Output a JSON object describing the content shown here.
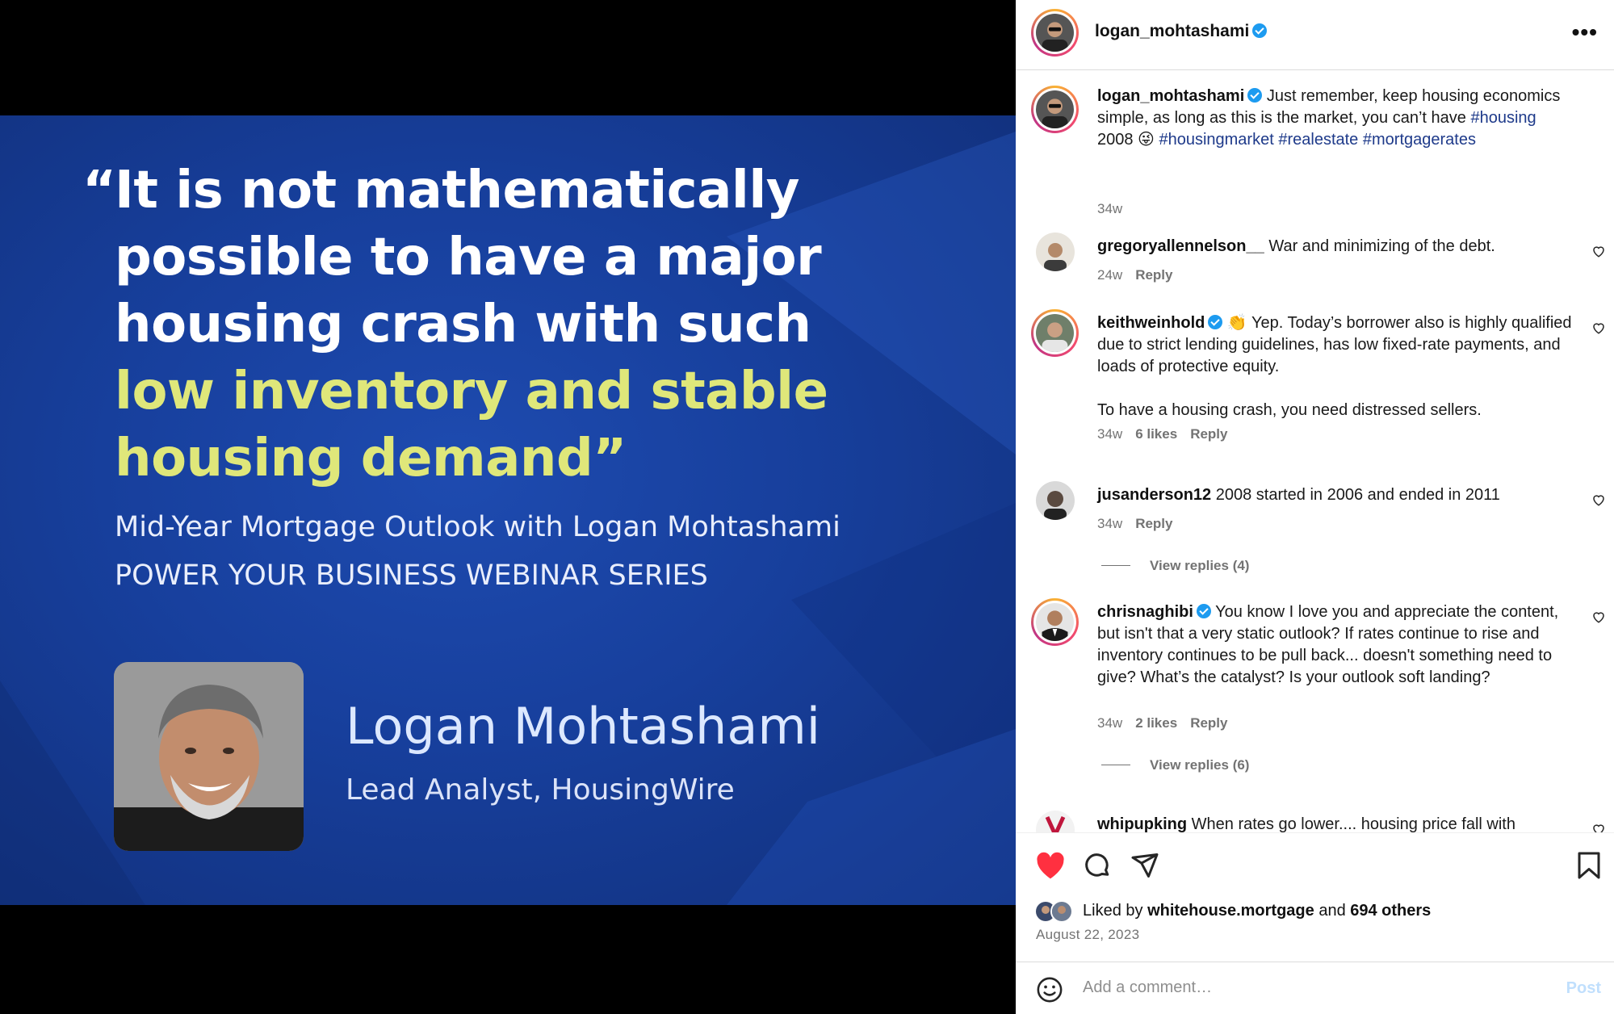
{
  "slide": {
    "quote_lines": [
      "It is not mathematically",
      "possible to have a major",
      "housing crash with such",
      "low inventory and stable",
      "housing demand”"
    ],
    "open_quote": "“",
    "subtitle_1": "Mid-Year Mortgage Outlook with Logan Mohtashami",
    "subtitle_2": "POWER YOUR BUSINESS WEBINAR SERIES",
    "speaker_name": "Logan Mohtashami",
    "speaker_title": "Lead Analyst, HousingWire",
    "colors": {
      "background": "#173f9c",
      "highlight": "#dfe77a"
    }
  },
  "header": {
    "username": "logan_mohtashami",
    "more": "•••"
  },
  "caption": {
    "username": "logan_mohtashami",
    "text_1": "Just remember, keep housing economics simple, as long as this is the market, you can’t have ",
    "tag_1": "#housing",
    "text_2": " 2008 😜 ",
    "tag_2": "#housingmarket",
    "tag_3": "#realestate",
    "tag_4": "#mortgagerates",
    "time": "34w"
  },
  "comments": [
    {
      "username": "gregoryallennelson__",
      "text": "War and minimizing of the debt.",
      "time": "24w",
      "likes": "",
      "reply": "Reply"
    },
    {
      "username": "keithweinhold",
      "text": "👏 Yep. Today’s borrower also is highly qualified due to strict lending guidelines, has low fixed-rate payments, and loads of protective equity.",
      "text_2": "To have a housing crash, you need distressed sellers.",
      "time": "34w",
      "likes": "6 likes",
      "reply": "Reply"
    },
    {
      "username": "jusanderson12",
      "text": "2008 started in 2006 and ended in 2011",
      "time": "34w",
      "likes": "",
      "reply": "Reply",
      "view_replies": "View replies (4)"
    },
    {
      "username": "chrisnaghibi",
      "text": "You know I love you and appreciate the content, but isn't that a very static outlook? If rates continue to rise and inventory continues to be pull back... doesn't something need to give? What’s the catalyst? Is your outlook soft landing?",
      "time": "34w",
      "likes": "2 likes",
      "reply": "Reply",
      "view_replies": "View replies (6)"
    },
    {
      "username": "whipupking",
      "text": "When rates go lower.... housing price fall with"
    }
  ],
  "likes": {
    "prefix": "Liked by ",
    "user": "whitehouse.mortgage",
    "middle": " and ",
    "count": "694 others"
  },
  "date": "August 22, 2023",
  "add_comment": {
    "placeholder": "Add a comment…",
    "post_label": "Post"
  },
  "colors": {
    "heart": "#ff3040",
    "tag": "#1e3a8a",
    "verified": "#1d9bf0",
    "muted": "#737373"
  }
}
